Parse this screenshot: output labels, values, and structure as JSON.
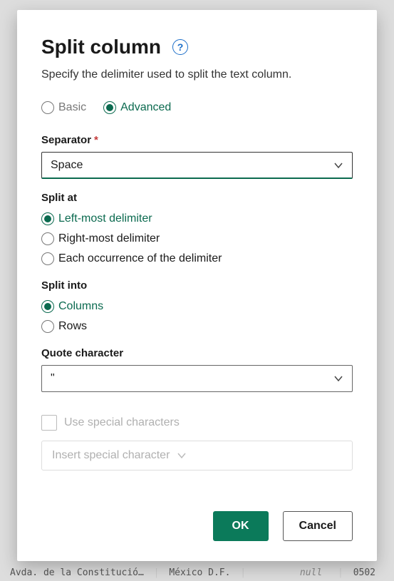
{
  "dialog": {
    "title": "Split column",
    "subtitle": "Specify the delimiter used to split the text column.",
    "help_glyph": "?",
    "mode": {
      "basic": "Basic",
      "advanced": "Advanced",
      "selected": "advanced"
    },
    "separator": {
      "label": "Separator",
      "required_mark": "*",
      "value": "Space"
    },
    "split_at": {
      "label": "Split at",
      "options": {
        "left": "Left-most delimiter",
        "right": "Right-most delimiter",
        "each": "Each occurrence of the delimiter"
      },
      "selected": "left"
    },
    "split_into": {
      "label": "Split into",
      "options": {
        "columns": "Columns",
        "rows": "Rows"
      },
      "selected": "columns"
    },
    "quote_char": {
      "label": "Quote character",
      "value": "\""
    },
    "special": {
      "checkbox_label": "Use special characters",
      "insert_label": "Insert special character"
    },
    "buttons": {
      "ok": "OK",
      "cancel": "Cancel"
    }
  },
  "backdrop": {
    "row_text_left": "Avda. de la Constitució…",
    "row_text_mid": "México D.F.",
    "row_text_null": "null",
    "row_text_right": "0502"
  }
}
